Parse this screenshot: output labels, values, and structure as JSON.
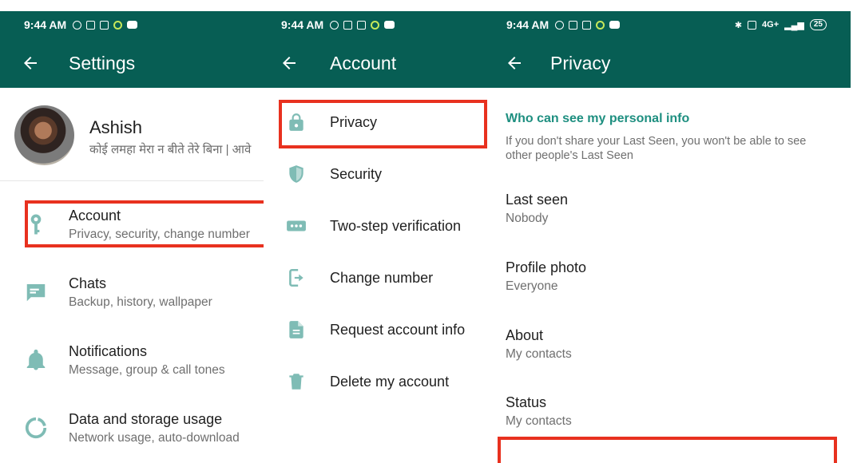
{
  "colors": {
    "header": "#075e54",
    "accent_icon": "#7fbcb5",
    "section_header": "#1e8f80",
    "highlight": "#e8311f"
  },
  "status_bar": {
    "time": "9:44 AM",
    "battery": "25",
    "network": "4G+"
  },
  "settings_panel": {
    "title": "Settings",
    "profile": {
      "name": "Ashish",
      "status": "कोई लमहा मेरा न बीते तेरे बिना | आवे"
    },
    "items": [
      {
        "icon": "key-icon",
        "title": "Account",
        "subtitle": "Privacy, security, change number"
      },
      {
        "icon": "chat-icon",
        "title": "Chats",
        "subtitle": "Backup, history, wallpaper"
      },
      {
        "icon": "bell-icon",
        "title": "Notifications",
        "subtitle": "Message, group & call tones"
      },
      {
        "icon": "data-usage-icon",
        "title": "Data and storage usage",
        "subtitle": "Network usage, auto-download"
      }
    ]
  },
  "account_panel": {
    "title": "Account",
    "items": [
      {
        "icon": "lock-icon",
        "label": "Privacy"
      },
      {
        "icon": "shield-icon",
        "label": "Security"
      },
      {
        "icon": "dots-icon",
        "label": "Two-step verification"
      },
      {
        "icon": "change-number-icon",
        "label": "Change number"
      },
      {
        "icon": "document-icon",
        "label": "Request account info"
      },
      {
        "icon": "trash-icon",
        "label": "Delete my account"
      }
    ]
  },
  "privacy_panel": {
    "title": "Privacy",
    "section_header": "Who can see my personal info",
    "section_desc": "If you don't share your Last Seen, you won't be able to see other people's Last Seen",
    "items": [
      {
        "title": "Last seen",
        "value": "Nobody"
      },
      {
        "title": "Profile photo",
        "value": "Everyone"
      },
      {
        "title": "About",
        "value": "My contacts"
      },
      {
        "title": "Status",
        "value": "My contacts"
      }
    ]
  }
}
